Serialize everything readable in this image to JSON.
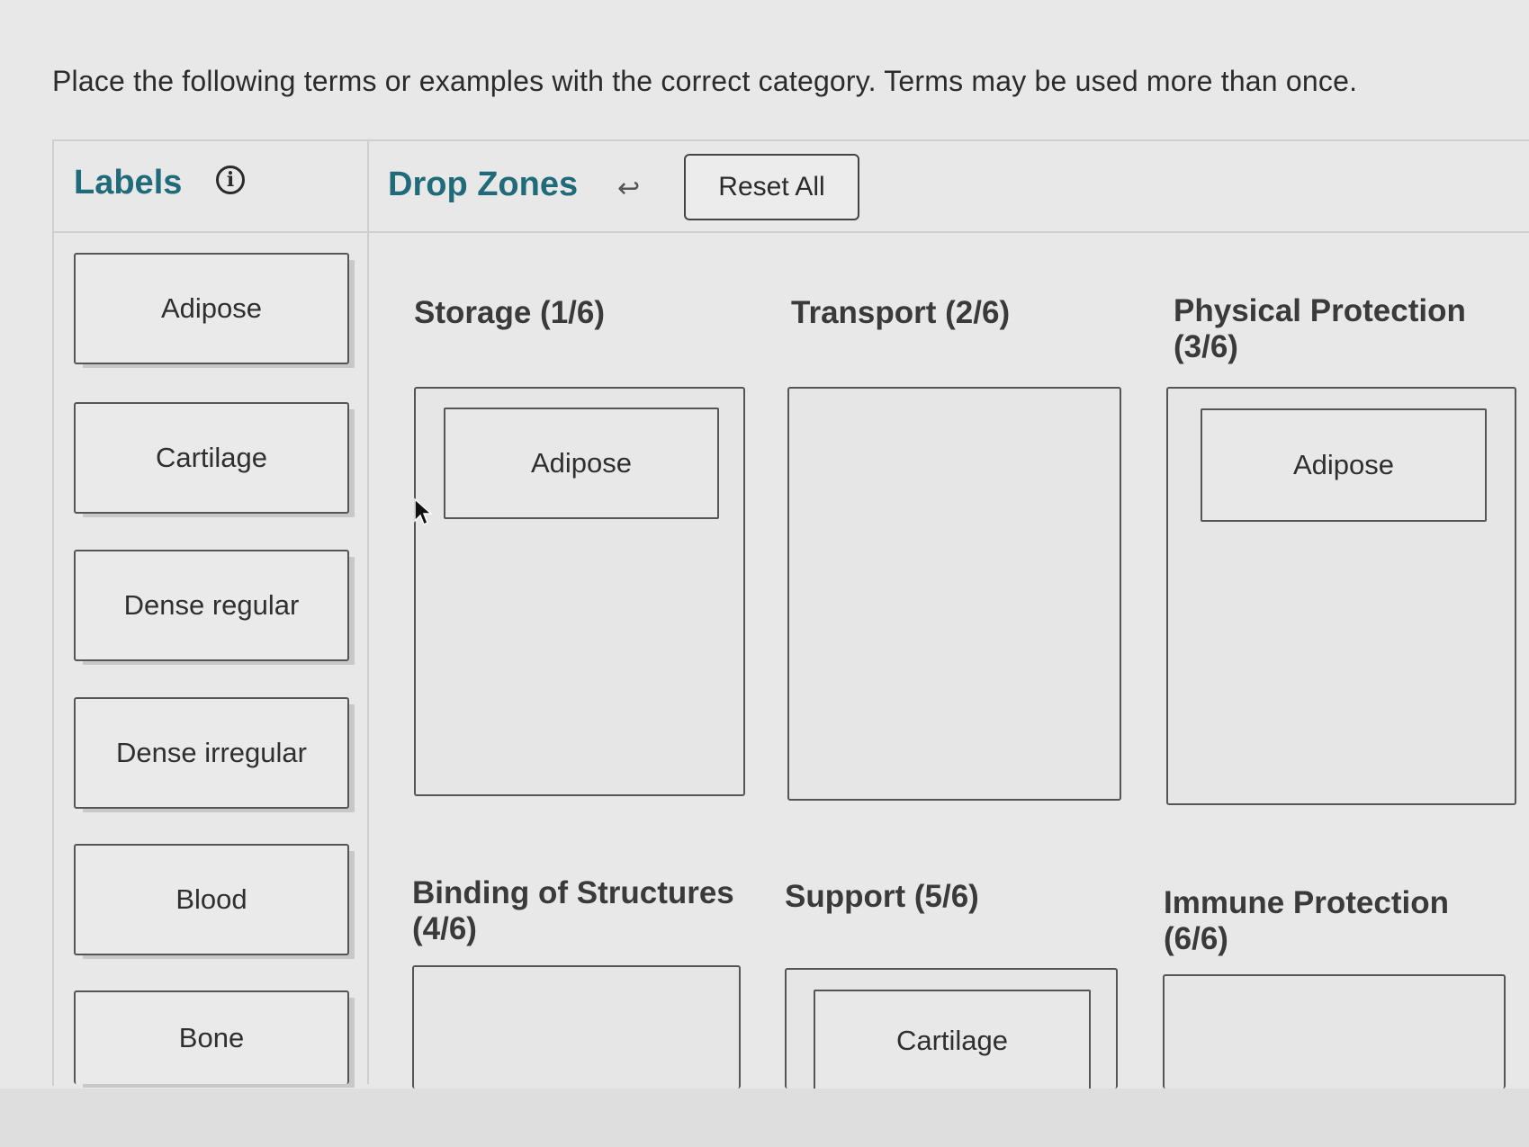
{
  "instruction": "Place the following terms or examples with the correct category.  Terms may be used more than once.",
  "labels_header": "Labels",
  "info_icon": "info-icon",
  "dropzones_header": "Drop Zones",
  "undo_icon": "undo-arrow-icon",
  "reset_label": "Reset All",
  "labels": [
    "Adipose",
    "Cartilage",
    "Dense regular",
    "Dense irregular",
    "Blood",
    "Bone"
  ],
  "zones": [
    {
      "title": "Storage (1/6)",
      "placed": [
        "Adipose"
      ]
    },
    {
      "title": "Transport (2/6)",
      "placed": []
    },
    {
      "title": "Physical Protection (3/6)",
      "placed": [
        "Adipose"
      ]
    },
    {
      "title": "Binding of Structures (4/6)",
      "placed": []
    },
    {
      "title": "Support (5/6)",
      "placed": [
        "Cartilage"
      ]
    },
    {
      "title": "Immune Protection (6/6)",
      "placed": []
    }
  ]
}
